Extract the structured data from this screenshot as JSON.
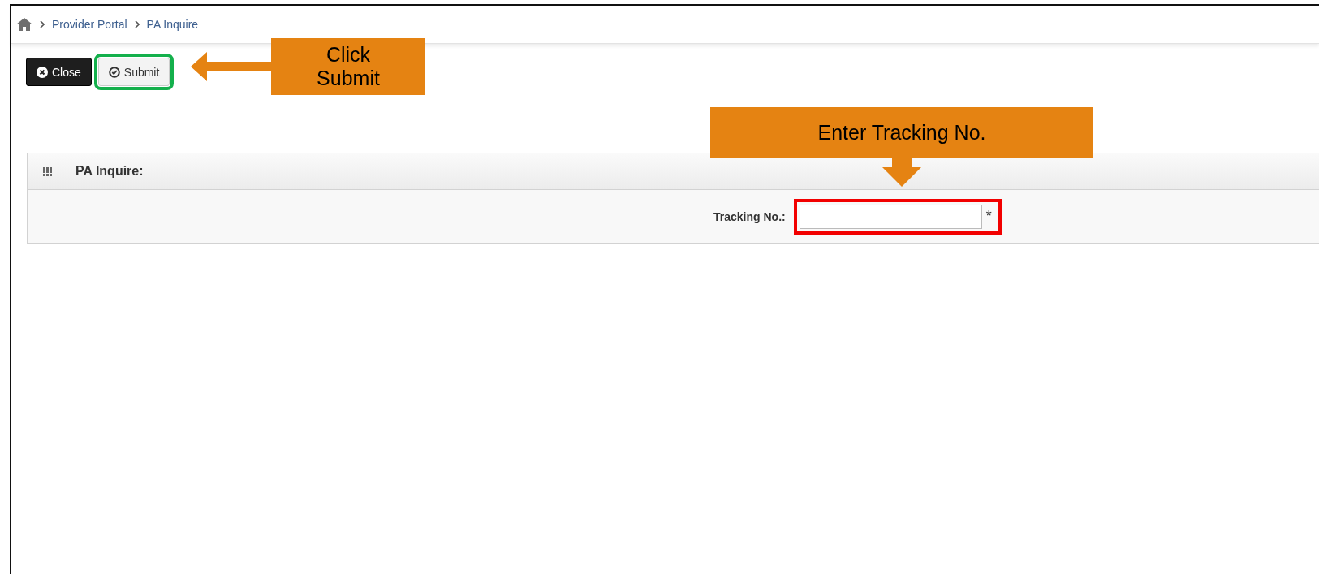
{
  "breadcrumb": [
    "Provider Portal",
    "PA Inquire"
  ],
  "toolbar": {
    "buttons": [
      {
        "label": "Close",
        "kind": "close",
        "highlighted": false
      },
      {
        "label": "Submit",
        "kind": "submit",
        "highlighted": true
      }
    ]
  },
  "panel": {
    "title": "PA Inquire:",
    "fields": [
      {
        "label": "Tracking No.:",
        "required_mark": "*",
        "highlighted": true
      }
    ]
  },
  "annotations": [
    {
      "text": "Click Submit",
      "kind": "left"
    },
    {
      "text": "Enter Tracking No.",
      "kind": "down"
    }
  ]
}
